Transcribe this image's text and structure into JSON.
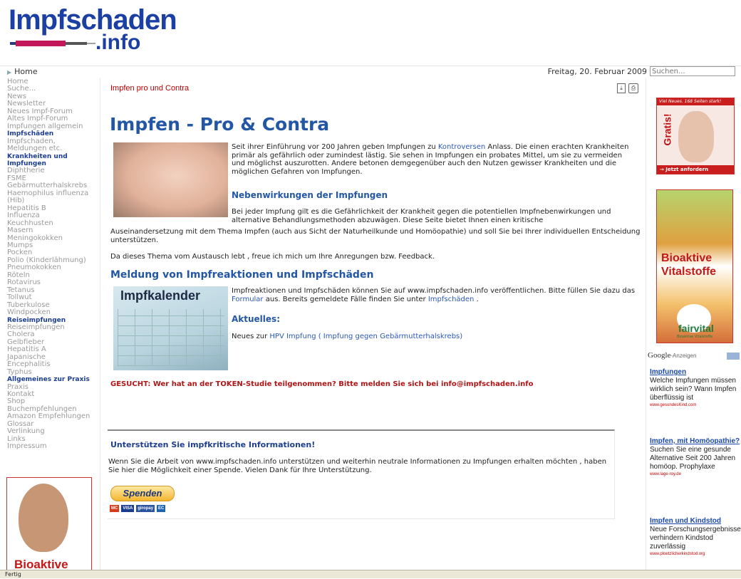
{
  "logo": {
    "top": "Impfschaden",
    "bottom": ".info"
  },
  "breadcrumb": {
    "label": "Home"
  },
  "date": "Freitag, 20. Februar 2009",
  "search": {
    "placeholder": "Suchen..."
  },
  "nav": [
    {
      "label": "Home",
      "type": "link"
    },
    {
      "label": "Suche...",
      "type": "link"
    },
    {
      "label": "News",
      "type": "link"
    },
    {
      "label": "Newsletter",
      "type": "link"
    },
    {
      "label": "Neues Impf-Forum",
      "type": "link"
    },
    {
      "label": "Altes Impf-Forum",
      "type": "link"
    },
    {
      "label": "Impfungen allgemein",
      "type": "link"
    },
    {
      "label": "Impfschäden",
      "type": "head"
    },
    {
      "label": "Impfschaden,",
      "type": "link"
    },
    {
      "label": "Meldungen etc.",
      "type": "link"
    },
    {
      "label": "Krankheiten und",
      "type": "head"
    },
    {
      "label": "Impfungen",
      "type": "head"
    },
    {
      "label": "Diphtherie",
      "type": "link"
    },
    {
      "label": "FSME",
      "type": "link"
    },
    {
      "label": "Gebärmutterhalskrebs",
      "type": "link"
    },
    {
      "label": "Haemophilus influenza",
      "type": "link"
    },
    {
      "label": "(Hib)",
      "type": "link"
    },
    {
      "label": "Hepatitis B",
      "type": "link"
    },
    {
      "label": "Influenza",
      "type": "link"
    },
    {
      "label": "Keuchhusten",
      "type": "link"
    },
    {
      "label": "Masern",
      "type": "link"
    },
    {
      "label": "Meningokokken",
      "type": "link"
    },
    {
      "label": "Mumps",
      "type": "link"
    },
    {
      "label": "Pocken",
      "type": "link"
    },
    {
      "label": "Polio (Kinderlähmung)",
      "type": "link"
    },
    {
      "label": "Pneumokokken",
      "type": "link"
    },
    {
      "label": "Röteln",
      "type": "link"
    },
    {
      "label": "Rotavirus",
      "type": "link"
    },
    {
      "label": "Tetanus",
      "type": "link"
    },
    {
      "label": "Tollwut",
      "type": "link"
    },
    {
      "label": "Tuberkulose",
      "type": "link"
    },
    {
      "label": "Windpocken",
      "type": "link"
    },
    {
      "label": "Reiseimpfungen",
      "type": "head"
    },
    {
      "label": "Reiseimpfungen",
      "type": "link"
    },
    {
      "label": "Cholera",
      "type": "link"
    },
    {
      "label": "Gelbfieber",
      "type": "link"
    },
    {
      "label": "Hepatitis A",
      "type": "link"
    },
    {
      "label": "Japanische",
      "type": "link"
    },
    {
      "label": "Encephalitis",
      "type": "link"
    },
    {
      "label": "Typhus",
      "type": "link"
    },
    {
      "label": "Allgemeines zur Praxis",
      "type": "head"
    },
    {
      "label": "Praxis",
      "type": "link"
    },
    {
      "label": "Kontakt",
      "type": "link"
    },
    {
      "label": "Shop",
      "type": "link"
    },
    {
      "label": "Buchempfehlungen",
      "type": "link"
    },
    {
      "label": "Amazon Empfehlungen",
      "type": "link"
    },
    {
      "label": "Glossar",
      "type": "link"
    },
    {
      "label": "Verlinkung",
      "type": "link"
    },
    {
      "label": "Links",
      "type": "link"
    },
    {
      "label": "Impressum",
      "type": "link"
    }
  ],
  "left_ad": {
    "text": "Bioaktive"
  },
  "main": {
    "section_title": "Impfen pro und Contra",
    "heading": "Impfen - Pro & Contra",
    "p1_before": "Seit ihrer Einführung vor 200 Jahren geben Impfungen zu ",
    "p1_link": "Kontroversen",
    "p1_after": " Anlass. Die einen erachten Krankheiten primär als gefährlich oder zumindest lästig. Sie sehen in Impfungen ein probates Mittel, um sie zu vermeiden und möglichst auszurotten. Andere betonen demgegenüber auch den Nutzen gewisser Krankheiten und die möglichen Gefahren von Impfungen.",
    "h_nebenwirkungen": "Nebenwirkungen der Impfungen",
    "p2_part1": "Bei jeder Impfung gilt es die Gefährlichkeit der Krankheit gegen die potentiellen Impfnebenwirkungen und alternative Behandlungsmethoden abzuwägen. Diese Seite bietet Ihnen einen kritische",
    "p2_part2": "Auseinandersetzung mit dem Thema Impfen (auch aus Sicht der Naturheilkunde und Homöopathie) und soll Sie bei Ihrer individuellen Entscheidung unterstützen.",
    "p3": "Da dieses Thema vom Austausch lebt , freue ich mich um Ihre Anregungen bzw. Feedback.",
    "h_meldung": "Meldung von Impfreaktionen und Impfschäden",
    "kalender_word": "Impfkalender",
    "p4_before": "Impfreaktionen und Impfschäden können Sie auf www.impfschaden.info veröffentlichen. Bitte füllen Sie dazu das ",
    "p4_link1": "Formular",
    "p4_mid": " aus. Bereits gemeldete Fälle finden Sie unter ",
    "p4_link2": "Impfschäden",
    "p4_after": " .",
    "h_aktuelles": "Aktuelles:",
    "p5_before": "Neues zur ",
    "p5_link": "HPV  Impfung ( Impfung gegen Gebärmutterhalskrebs)",
    "gesucht": "GESUCHT: Wer hat an der TOKEN-Studie teilgenommen? Bitte melden Sie sich bei info@impfschaden.info",
    "support_title": "Unterstützen Sie impfkritische Informationen!",
    "support_text": "Wenn Sie die Arbeit von www.impfschaden.info unterstützen und weiterhin neutrale Informationen zu Impfungen erhalten möchten , haben Sie hier die Möglichkeit einer Spende. Vielen Dank für Ihre Unterstützung.",
    "donate_label": "Spenden",
    "cards": [
      {
        "label": "MC",
        "color": "#d83a1c"
      },
      {
        "label": "VISA",
        "color": "#1a3c8f"
      },
      {
        "label": "giropay",
        "color": "#2b54a0"
      },
      {
        "label": "EC",
        "color": "#1d63b0"
      }
    ]
  },
  "right": {
    "ad1_band": "Viel Neues. 168 Seiten stark!",
    "ad1_gratis": "Gratis!",
    "ad1_bottom": "→ Jetzt anfordern",
    "ad2_title": "Bioaktive Vitalstoffe",
    "ad2_brand": "fairvital",
    "ad2_sub": "Bioaktive Vitalstoffe",
    "google_brand": "Google",
    "google_label": "-Anzeigen",
    "ads": [
      {
        "title": "Impfungen",
        "desc": "Welche Impfungen müssen wirklich sein? Wann Impfen überflüssig ist",
        "url": "www.gesundesKind.com"
      },
      {
        "title": "Impfen, mit Homöopathie?",
        "desc": "Suchen Sie eine gesunde Alternative Seit 200 Jahren homöop. Prophylaxe",
        "url": "www.lage-roy.de"
      },
      {
        "title": "Impfen und Kindstod",
        "desc": "Neue Forschungsergebnisse verhindern Kindstod zuverlässig",
        "url": "www.ploetzlicherkindstod.org"
      }
    ]
  },
  "status": "Fertig"
}
